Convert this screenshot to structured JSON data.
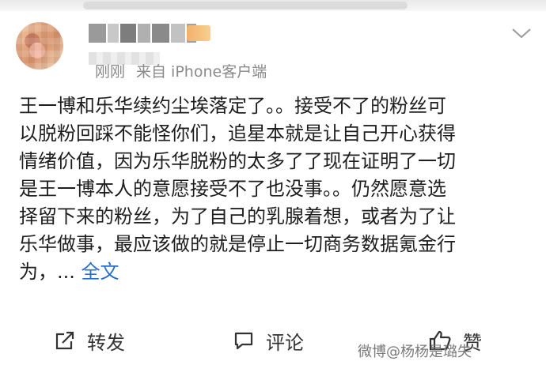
{
  "post": {
    "meta": {
      "time": "刚刚",
      "source": "来自 iPhone客户端"
    },
    "body_lines": [
      "王一博和乐华续约尘埃落定了。。接受不了的粉丝可",
      "以脱粉回踩不能怪你们，追星本就是让自己开心获得",
      "情绪价值，因为乐华脱粉的太多了了现在证明了一切",
      "是王一博本人的意愿接受不了也没事。。仍然愿意选",
      "择留下来的粉丝，为了自己的乳腺着想，或者为了让",
      "乐华做事，最应该做的就是停止一切商务数据氪金行"
    ],
    "last_line_text": "为，...",
    "more_label": "全文"
  },
  "actions": {
    "repost_label": "转发",
    "comment_label": "评论",
    "like_label": "赞"
  },
  "watermark": "微博@杨杨是璐失",
  "icons": {
    "menu": "chevron-down-icon",
    "repost": "repost-icon",
    "comment": "comment-icon",
    "like": "thumbs-up-icon"
  },
  "colors": {
    "link": "#2a6dc9",
    "meta_text": "#8a8a8a",
    "icon": "#333333"
  }
}
